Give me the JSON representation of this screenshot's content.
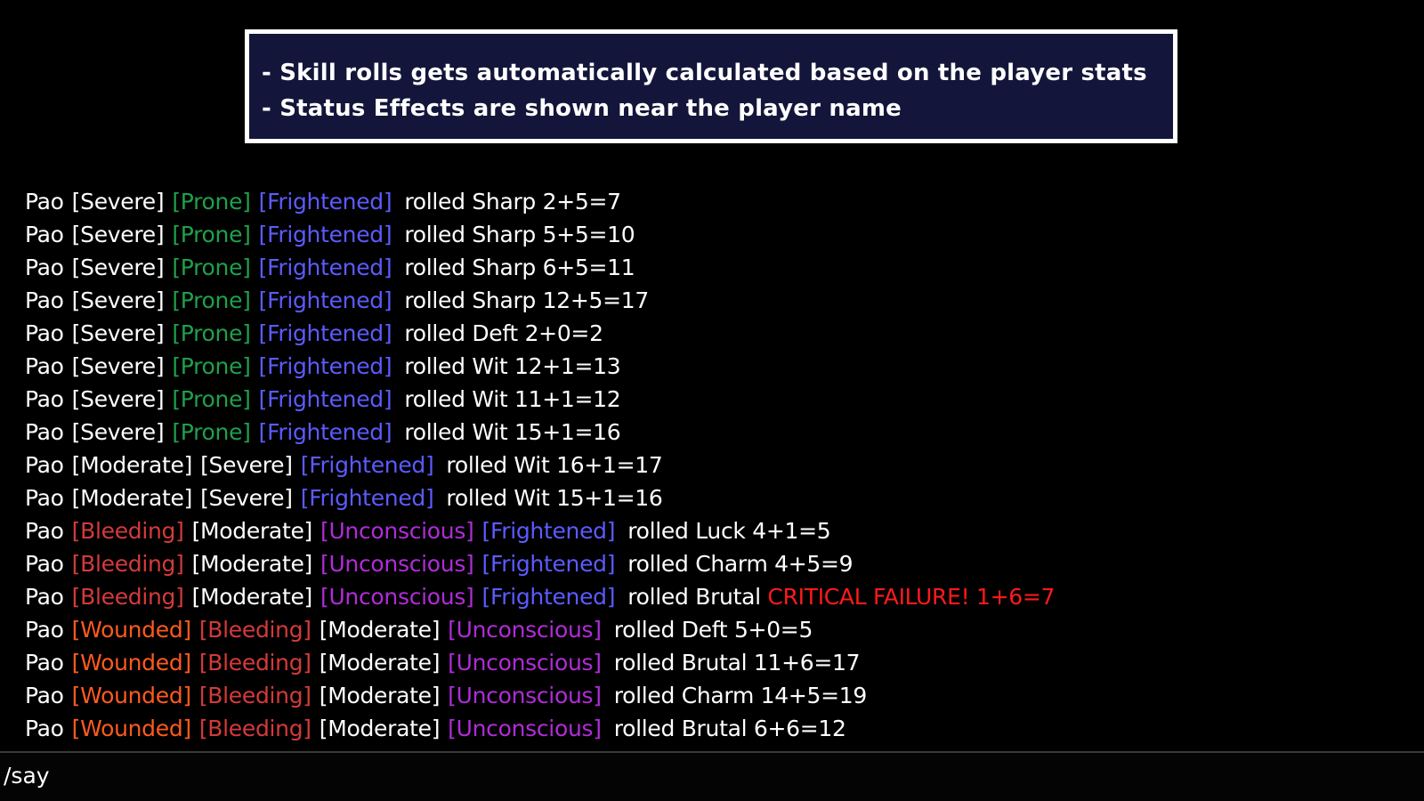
{
  "info_box": {
    "lines": [
      "- Skill rolls gets automatically calculated based on the player stats",
      "- Status Effects are shown near the player name"
    ]
  },
  "colors": {
    "Severe": "#ffffff",
    "Moderate": "#ffffff",
    "Prone": "#1fa04a",
    "Frightened": "#5b5bff",
    "Bleeding": "#d43a3a",
    "Unconscious": "#b02cd8",
    "Wounded": "#ff5a1e",
    "critical": "#ff1a1a",
    "player": "#ffffff"
  },
  "chat": {
    "lines": [
      {
        "player": "Pao",
        "effects": [
          "Severe",
          "Prone",
          "Frightened"
        ],
        "roll": "rolled Sharp 2+5=7"
      },
      {
        "player": "Pao",
        "effects": [
          "Severe",
          "Prone",
          "Frightened"
        ],
        "roll": "rolled Sharp 5+5=10"
      },
      {
        "player": "Pao",
        "effects": [
          "Severe",
          "Prone",
          "Frightened"
        ],
        "roll": "rolled Sharp 6+5=11"
      },
      {
        "player": "Pao",
        "effects": [
          "Severe",
          "Prone",
          "Frightened"
        ],
        "roll": "rolled Sharp 12+5=17"
      },
      {
        "player": "Pao",
        "effects": [
          "Severe",
          "Prone",
          "Frightened"
        ],
        "roll": "rolled Deft 2+0=2"
      },
      {
        "player": "Pao",
        "effects": [
          "Severe",
          "Prone",
          "Frightened"
        ],
        "roll": "rolled Wit 12+1=13"
      },
      {
        "player": "Pao",
        "effects": [
          "Severe",
          "Prone",
          "Frightened"
        ],
        "roll": "rolled Wit 11+1=12"
      },
      {
        "player": "Pao",
        "effects": [
          "Severe",
          "Prone",
          "Frightened"
        ],
        "roll": "rolled Wit 15+1=16"
      },
      {
        "player": "Pao",
        "effects": [
          "Moderate",
          "Severe",
          "Frightened"
        ],
        "roll": "rolled Wit 16+1=17"
      },
      {
        "player": "Pao",
        "effects": [
          "Moderate",
          "Severe",
          "Frightened"
        ],
        "roll": "rolled Wit 15+1=16"
      },
      {
        "player": "Pao",
        "effects": [
          "Bleeding",
          "Moderate",
          "Unconscious",
          "Frightened"
        ],
        "roll": "rolled Luck 4+1=5"
      },
      {
        "player": "Pao",
        "effects": [
          "Bleeding",
          "Moderate",
          "Unconscious",
          "Frightened"
        ],
        "roll": "rolled Charm 4+5=9"
      },
      {
        "player": "Pao",
        "effects": [
          "Bleeding",
          "Moderate",
          "Unconscious",
          "Frightened"
        ],
        "roll": "rolled Brutal",
        "critical": "CRITICAL FAILURE! 1+6=7"
      },
      {
        "player": "Pao",
        "effects": [
          "Wounded",
          "Bleeding",
          "Moderate",
          "Unconscious"
        ],
        "roll": "rolled Deft 5+0=5"
      },
      {
        "player": "Pao",
        "effects": [
          "Wounded",
          "Bleeding",
          "Moderate",
          "Unconscious"
        ],
        "roll": "rolled Brutal 11+6=17"
      },
      {
        "player": "Pao",
        "effects": [
          "Wounded",
          "Bleeding",
          "Moderate",
          "Unconscious"
        ],
        "roll": "rolled Charm 14+5=19"
      },
      {
        "player": "Pao",
        "effects": [
          "Wounded",
          "Bleeding",
          "Moderate",
          "Unconscious"
        ],
        "roll": "rolled Brutal 6+6=12"
      }
    ]
  },
  "input": {
    "value": "/say"
  }
}
